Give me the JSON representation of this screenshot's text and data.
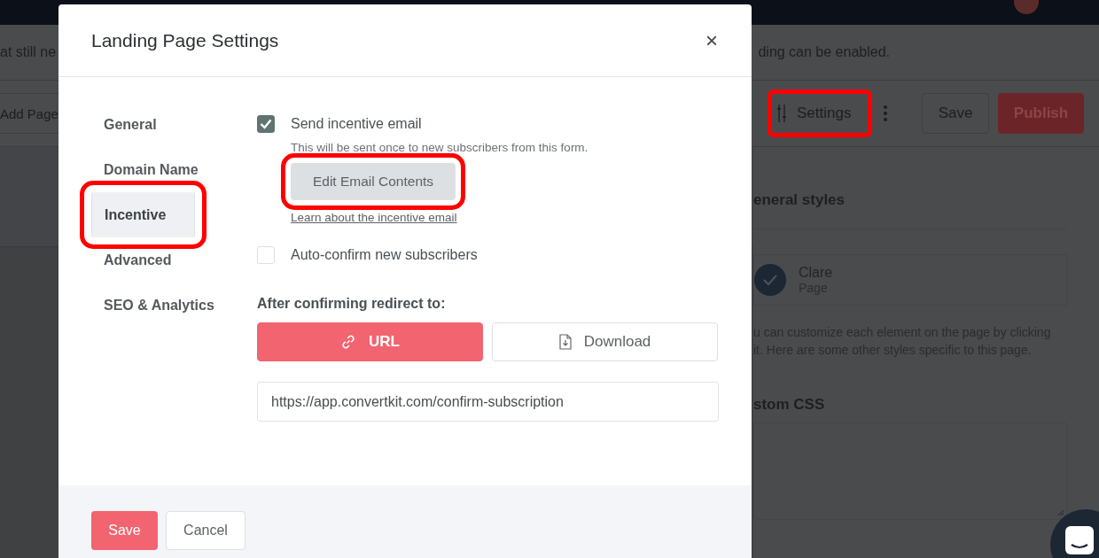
{
  "background": {
    "notice_left": "at still ne",
    "notice_right": "ding can be enabled.",
    "toolbar": {
      "add_page": "Add Page",
      "settings": {
        "label": "Settings",
        "highlighted": true
      },
      "save": "Save",
      "publish": "Publish"
    },
    "panel": {
      "heading": "eneral styles",
      "template": {
        "name": "Clare",
        "type": "Page"
      },
      "description": [
        "u can customize each element on the page by clicking",
        "it. Here are some other styles specific to this page."
      ],
      "css_label": "stom CSS"
    }
  },
  "modal": {
    "title": "Landing Page Settings",
    "close": "×",
    "nav": [
      {
        "label": "General",
        "selected": false,
        "highlighted": false
      },
      {
        "label": "Domain Name",
        "selected": false,
        "highlighted": false
      },
      {
        "label": "Incentive",
        "selected": true,
        "highlighted": true
      },
      {
        "label": "Advanced",
        "selected": false,
        "highlighted": false
      },
      {
        "label": "SEO & Analytics",
        "selected": false,
        "highlighted": false
      }
    ],
    "incentive": {
      "checked": true,
      "label": "Send incentive email",
      "hint": "This will be sent once to new subscribers from this form.",
      "edit_button": {
        "label": "Edit Email Contents",
        "highlighted": true
      },
      "link": "Learn about the incentive email"
    },
    "auto_confirm": {
      "checked": false,
      "label": "Auto-confirm new subscribers"
    },
    "redirect": {
      "label": "After confirming redirect to:",
      "options": [
        {
          "label": "URL",
          "kind": "link",
          "selected": true
        },
        {
          "label": "Download",
          "kind": "download",
          "selected": false
        }
      ],
      "url": "https://app.convertkit.com/confirm-subscription"
    },
    "footer": {
      "save": "Save",
      "cancel": "Cancel"
    }
  }
}
